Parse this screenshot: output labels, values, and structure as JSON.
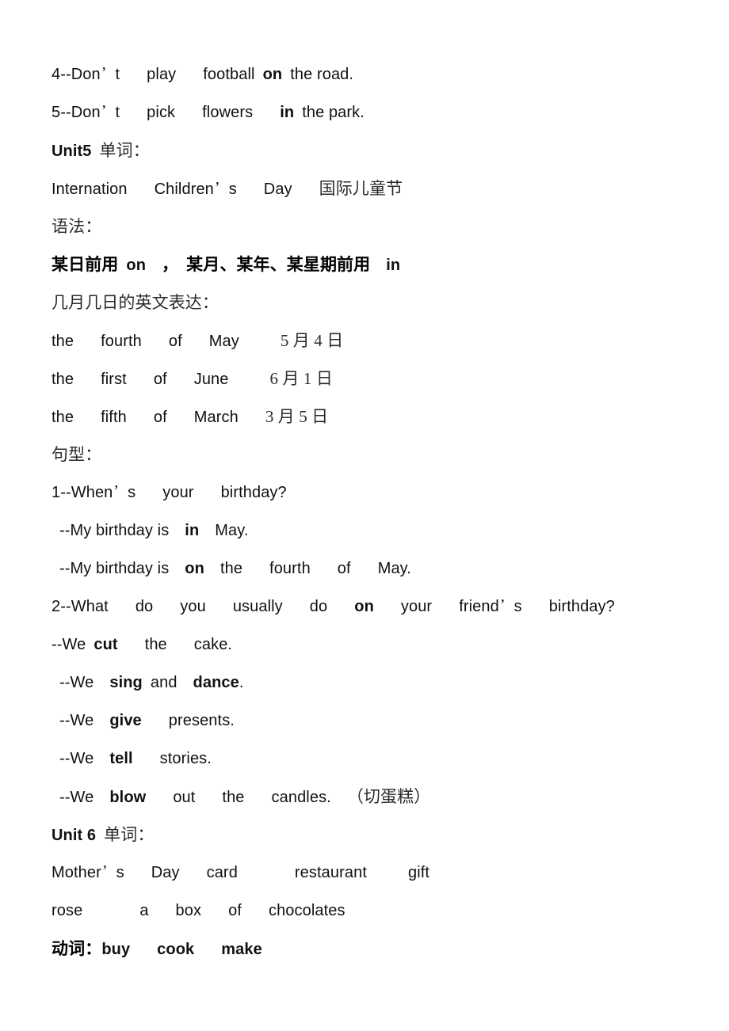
{
  "document": {
    "background_color": "#ffffff",
    "text_color": "#111111",
    "lines": {
      "l1_num": "4--Don",
      "l1_apos": "’",
      "l1_a": "t",
      "l1_b": "play",
      "l1_c": "football",
      "l1_bold": "on",
      "l1_d": "the road.",
      "l2_num": "5--Don",
      "l2_apos": "’",
      "l2_a": "t",
      "l2_b": "pick",
      "l2_c": "flowers",
      "l2_bold": "in",
      "l2_d": "the park.",
      "unit5_label": "Unit5",
      "unit5_cn": "单词：",
      "vocab5_a": "Internation",
      "vocab5_b": "Children",
      "vocab5_apos": "’",
      "vocab5_c": "s",
      "vocab5_d": "Day",
      "vocab5_cn": "国际儿童节",
      "grammar_label": "语法：",
      "grammar_rule_a": "某日前用",
      "grammar_rule_on": "on",
      "grammar_rule_b": "，",
      "grammar_rule_c": "某月、某年、某星期前用",
      "grammar_rule_in": "in",
      "date_expr_label": "几月几日的英文表达：",
      "d1_a": "the",
      "d1_b": "fourth",
      "d1_c": "of",
      "d1_d": "May",
      "d1_cn": "5 月 4 日",
      "d2_a": "the",
      "d2_b": "first",
      "d2_c": "of",
      "d2_d": "June",
      "d2_cn": "6 月 1 日",
      "d3_a": "the",
      "d3_b": "fifth",
      "d3_c": "of",
      "d3_d": "March",
      "d3_cn": "3 月 5 日",
      "sentence_label": "句型：",
      "s1_q_a": "1--When",
      "s1_q_apos": "’",
      "s1_q_b": "s",
      "s1_q_c": "your",
      "s1_q_d": "birthday?",
      "s1_a1_a": "--My birthday is",
      "s1_a1_bold": "in",
      "s1_a1_b": "May.",
      "s1_a2_a": "--My birthday is",
      "s1_a2_bold": "on",
      "s1_a2_b": "the",
      "s1_a2_c": "fourth",
      "s1_a2_d": "of",
      "s1_a2_e": "May.",
      "s2_q_a": "2--What",
      "s2_q_b": "do",
      "s2_q_c": "you",
      "s2_q_d": "usually",
      "s2_q_e": "do",
      "s2_q_bold": "on",
      "s2_q_f": "your",
      "s2_q_g": "friend",
      "s2_q_apos": "’",
      "s2_q_h": "s",
      "s2_q_i": "birthday?",
      "s2_a1_a": "--We",
      "s2_a1_bold": "cut",
      "s2_a1_b": "the",
      "s2_a1_c": "cake.",
      "s2_a2_a": "--We",
      "s2_a2_bold1": "sing",
      "s2_a2_b": "and",
      "s2_a2_bold2": "dance",
      "s2_a2_c": ".",
      "s2_a3_a": "--We",
      "s2_a3_bold": "give",
      "s2_a3_b": "presents.",
      "s2_a4_a": "--We",
      "s2_a4_bold": "tell",
      "s2_a4_b": "stories.",
      "s2_a5_a": "--We",
      "s2_a5_bold": "blow",
      "s2_a5_b": "out",
      "s2_a5_c": "the",
      "s2_a5_d": "candles.",
      "s2_a5_cn": "（切蛋糕）",
      "unit6_label": "Unit 6",
      "unit6_cn": "单词：",
      "vocab6_a": "Mother",
      "vocab6_apos": "’",
      "vocab6_b": "s",
      "vocab6_c": "Day",
      "vocab6_d": "card",
      "vocab6_e": "restaurant",
      "vocab6_f": "gift",
      "vocab6_g": "rose",
      "vocab6_h": "a",
      "vocab6_i": "box",
      "vocab6_j": "of",
      "vocab6_k": "chocolates",
      "verbs_label": "动词：",
      "verb_1": "buy",
      "verb_2": "cook",
      "verb_3": "make"
    }
  }
}
